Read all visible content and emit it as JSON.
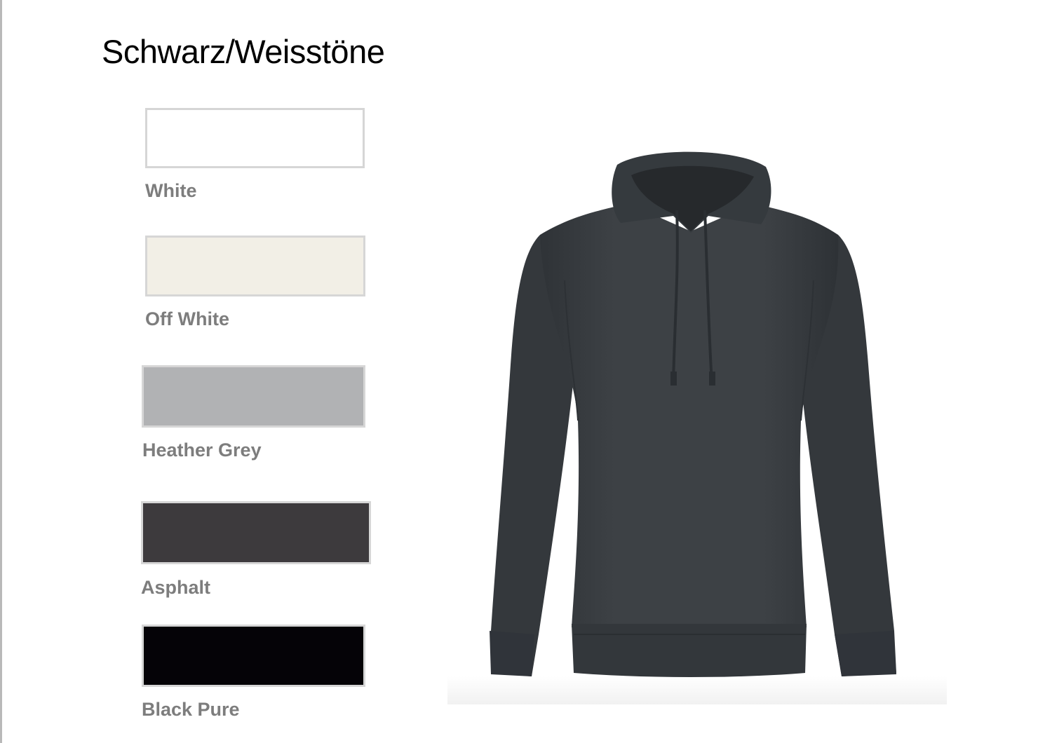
{
  "page": {
    "title": "Schwarz/Weisstöne"
  },
  "swatches": [
    {
      "label": "White",
      "color": "#ffffff"
    },
    {
      "label": "Off White",
      "color": "#f2efe6"
    },
    {
      "label": "Heather Grey",
      "color": "#b1b2b4"
    },
    {
      "label": "Asphalt",
      "color": "#3d3a3d"
    },
    {
      "label": "Black Pure",
      "color": "#050307"
    }
  ],
  "product": {
    "garment_color": "#3b3f43",
    "icon": "hoodie-icon"
  }
}
